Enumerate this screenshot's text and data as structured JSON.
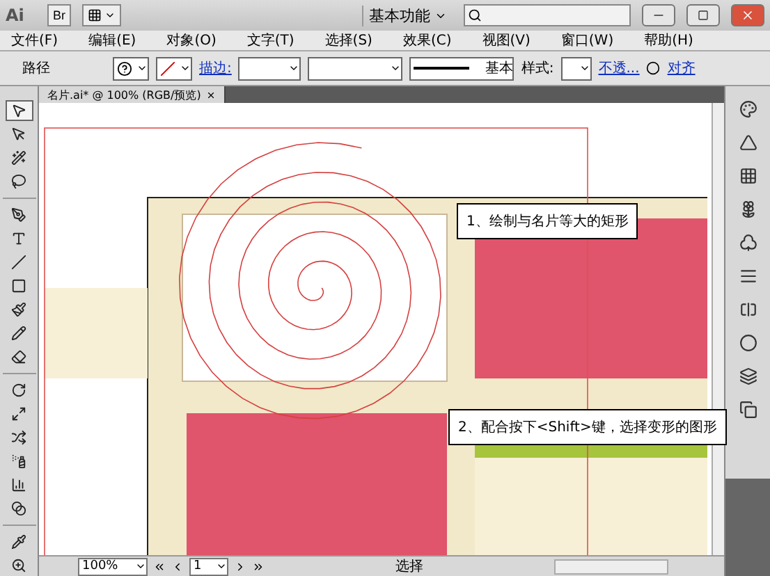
{
  "title_bar": {
    "logo": "Ai",
    "bridge_button": "Br",
    "workspace": "基本功能"
  },
  "menu": [
    "文件(F)",
    "编辑(E)",
    "对象(O)",
    "文字(T)",
    "选择(S)",
    "效果(C)",
    "视图(V)",
    "窗口(W)",
    "帮助(H)"
  ],
  "control_bar": {
    "selection": "路径",
    "stroke_label": "描边:",
    "stroke_profile": "基本",
    "style_label": "样式:",
    "opacity_link": "不透...",
    "align_link": "对齐"
  },
  "document_tab": {
    "title": "名片.ai* @ 100% (RGB/预览)"
  },
  "tools": [
    {
      "selected": true
    },
    {
      "selected": false
    },
    {
      "selected": false
    },
    {
      "selected": false
    },
    {
      "selected": false
    },
    {
      "selected": false
    },
    {
      "selected": false
    },
    {
      "selected": false
    },
    {
      "selected": false
    },
    {
      "selected": false
    },
    {
      "selected": false
    },
    {
      "selected": false
    },
    {
      "selected": false
    },
    {
      "selected": false
    },
    {
      "selected": false
    },
    {
      "selected": false
    },
    {
      "selected": false
    },
    {
      "selected": false
    },
    {
      "selected": false
    }
  ],
  "callouts": [
    {
      "text": "1、绘制与名片等大的矩形"
    },
    {
      "text": "2、配合按下<Shift>键，选择变形的图形"
    }
  ],
  "status_bar": {
    "zoom": "100%",
    "artboard": "1",
    "tool": "选择"
  }
}
